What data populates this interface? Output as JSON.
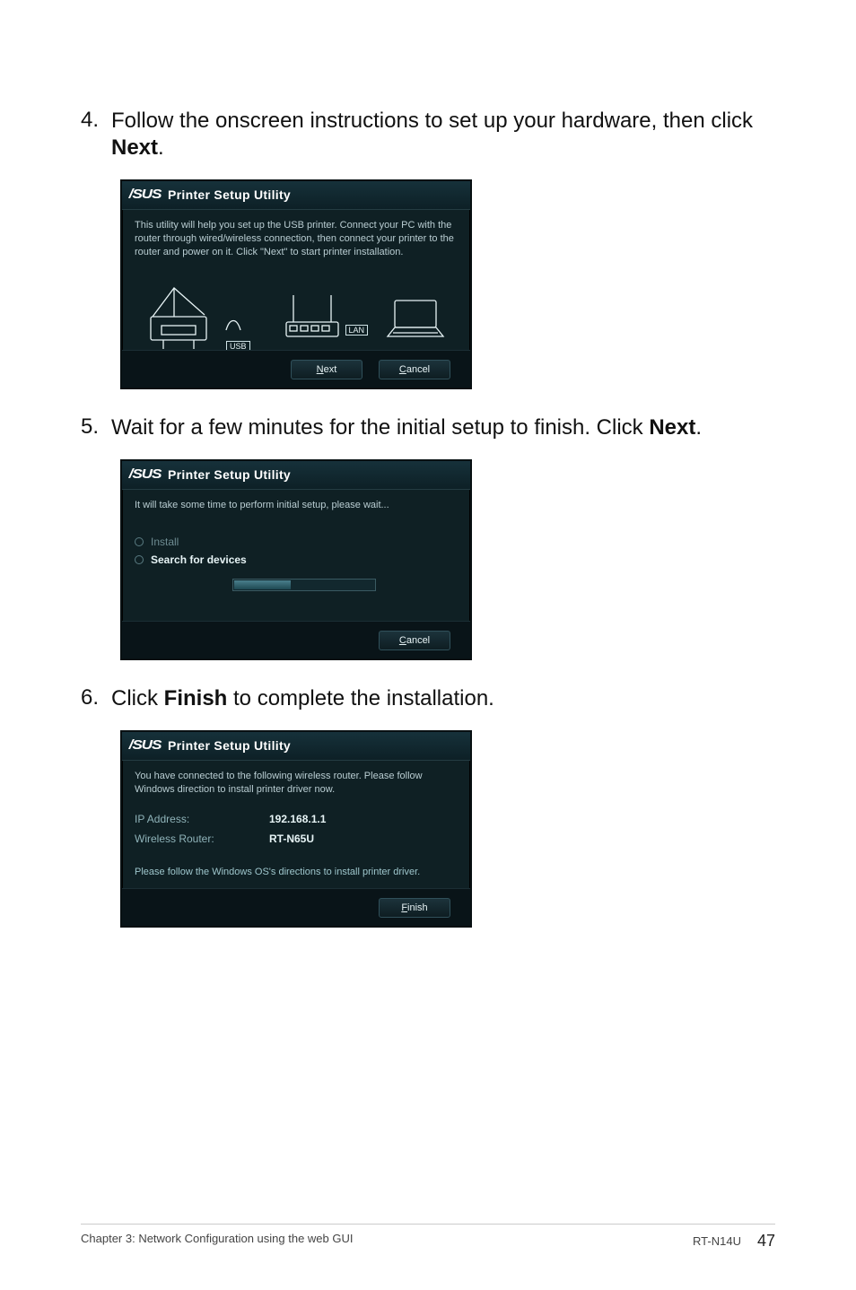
{
  "steps": {
    "s4": {
      "num": "4.",
      "text_a": "Follow the onscreen instructions to set up your hardware, then click ",
      "bold": "Next",
      "text_b": "."
    },
    "s5": {
      "num": "5.",
      "text_a": "Wait for a few minutes for the initial setup to finish. Click ",
      "bold": "Next",
      "text_b": "."
    },
    "s6": {
      "num": "6.",
      "text_a": "Click ",
      "bold": "Finish",
      "text_b": " to complete the installation."
    }
  },
  "shot1": {
    "logo": "/SUS",
    "title": "Printer Setup Utility",
    "desc": "This utility will help you set up the USB printer. Connect your PC with the router through wired/wireless connection, then connect your printer to the router and power on it. Click \"Next\" to start printer installation.",
    "usb_label": "USB",
    "lan_label": "LAN",
    "next": {
      "u": "N",
      "rest": "ext"
    },
    "cancel": {
      "u": "C",
      "rest": "ancel"
    }
  },
  "shot2": {
    "logo": "/SUS",
    "title": "Printer Setup Utility",
    "desc": "It will take some time to perform initial setup, please wait...",
    "opt_install": "Install",
    "opt_search": "Search for devices",
    "cancel": {
      "u": "C",
      "rest": "ancel"
    }
  },
  "shot3": {
    "logo": "/SUS",
    "title": "Printer Setup Utility",
    "desc": "You have connected to the following wireless router. Please follow Windows direction to install printer driver now.",
    "ip_k": "IP Address:",
    "ip_v": "192.168.1.1",
    "wr_k": "Wireless Router:",
    "wr_v": "RT-N65U",
    "note": "Please follow the Windows OS's directions to install printer driver.",
    "finish": {
      "u": "F",
      "rest": "inish"
    }
  },
  "footer": {
    "left": "Chapter 3: Network Configuration using the web GUI",
    "right_label": "RT-N14U",
    "page": "47"
  }
}
